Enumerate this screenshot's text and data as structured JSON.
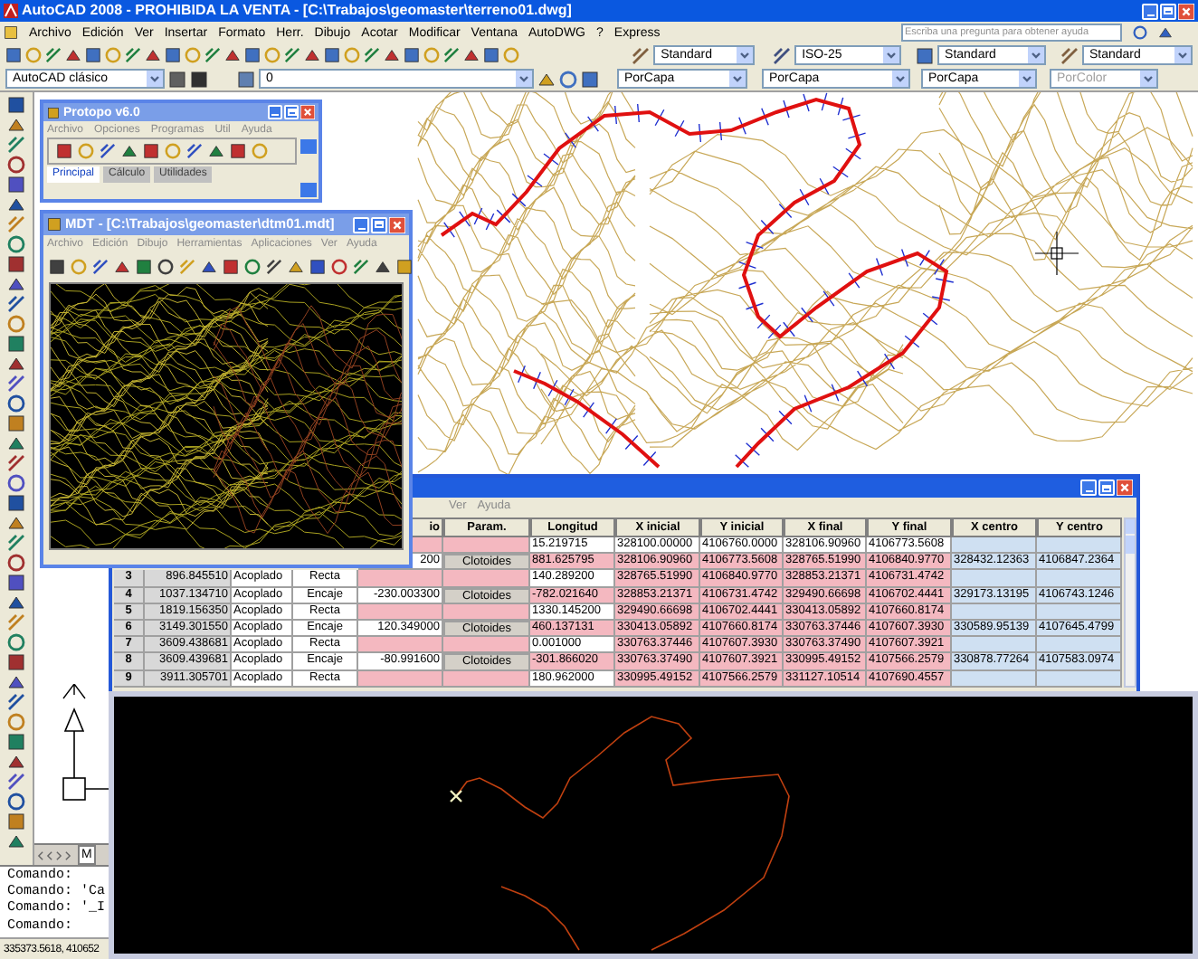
{
  "window": {
    "title": "AutoCAD 2008 - PROHIBIDA LA VENTA - [C:\\Trabajos\\geomaster\\terreno01.dwg]"
  },
  "menu": [
    "Archivo",
    "Edición",
    "Ver",
    "Insertar",
    "Formato",
    "Herr.",
    "Dibujo",
    "Acotar",
    "Modificar",
    "Ventana",
    "AutoDWG",
    "?",
    "Express"
  ],
  "help_search": {
    "placeholder": "Escriba una pregunta para obtener ayuda"
  },
  "toolbar_1": {
    "text_style": "Standard",
    "dim_style": "ISO-25",
    "table_style": "Standard",
    "multileader_style": "Standard"
  },
  "toolbar_2": {
    "workspace": "AutoCAD clásico",
    "layer": "0",
    "color_setting": "PorCapa",
    "linetype": "PorCapa",
    "lineweight": "PorCapa",
    "plot_style": {
      "value": "PorColor",
      "disabled": true
    }
  },
  "layout_tabs": [
    "M"
  ],
  "protopo": {
    "title": "Protopo v6.0",
    "menu": [
      "Archivo",
      "Opciones",
      "Programas",
      "Util",
      "Ayuda"
    ],
    "tabs": [
      {
        "label": "Principal",
        "selected": true
      },
      {
        "label": "Cálculo",
        "selected": false
      },
      {
        "label": "Utilidades",
        "selected": false
      }
    ]
  },
  "mdt": {
    "title": "MDT - [C:\\Trabajos\\geomaster\\dtm01.mdt]",
    "menu": [
      "Archivo",
      "Edición",
      "Dibujo",
      "Herramientas",
      "Aplicaciones",
      "Ver",
      "Ayuda"
    ]
  },
  "alignment_table": {
    "menu": [
      "Ver",
      "Ayuda"
    ],
    "columns": [
      "io",
      "Param.",
      "Longitud",
      "X inicial",
      "Y inicial",
      "X final",
      "Y final",
      "X centro",
      "Y centro"
    ],
    "rows": [
      {
        "kind": "start",
        "longitud": "15.219715",
        "x_inicial": "328100.00000",
        "y_inicial": "4106760.0000",
        "x_final": "328106.90960",
        "y_final": "4106773.5608"
      },
      {
        "kind": "encaje",
        "io": "200",
        "param": "Clotoides",
        "longitud": "881.625795",
        "x_inicial": "328106.90960",
        "y_inicial": "4106773.5608",
        "x_final": "328765.51990",
        "y_final": "4106840.9770",
        "x_centro": "328432.12363",
        "y_centro": "4106847.2364"
      },
      {
        "kind": "recta",
        "number": "3",
        "station": "896.845510",
        "link": "Acoplado",
        "type": "Recta",
        "longitud": "140.289200",
        "x_inicial": "328765.51990",
        "y_inicial": "4106840.9770",
        "x_final": "328853.21371",
        "y_final": "4106731.4742"
      },
      {
        "kind": "encaje",
        "number": "4",
        "station": "1037.134710",
        "link": "Acoplado",
        "type": "Encaje",
        "io": "-230.003300",
        "param": "Clotoides",
        "longitud": "-782.021640",
        "x_inicial": "328853.21371",
        "y_inicial": "4106731.4742",
        "x_final": "329490.66698",
        "y_final": "4106702.4441",
        "x_centro": "329173.13195",
        "y_centro": "4106743.1246"
      },
      {
        "kind": "recta",
        "number": "5",
        "station": "1819.156350",
        "link": "Acoplado",
        "type": "Recta",
        "longitud": "1330.145200",
        "x_inicial": "329490.66698",
        "y_inicial": "4106702.4441",
        "x_final": "330413.05892",
        "y_final": "4107660.8174"
      },
      {
        "kind": "encaje",
        "number": "6",
        "station": "3149.301550",
        "link": "Acoplado",
        "type": "Encaje",
        "io": "120.349000",
        "param": "Clotoides",
        "longitud": "460.137131",
        "x_inicial": "330413.05892",
        "y_inicial": "4107660.8174",
        "x_final": "330763.37446",
        "y_final": "4107607.3930",
        "x_centro": "330589.95139",
        "y_centro": "4107645.4799"
      },
      {
        "kind": "recta",
        "number": "7",
        "station": "3609.438681",
        "link": "Acoplado",
        "type": "Recta",
        "longitud": "0.001000",
        "x_inicial": "330763.37446",
        "y_inicial": "4107607.3930",
        "x_final": "330763.37490",
        "y_final": "4107607.3921"
      },
      {
        "kind": "encaje",
        "number": "8",
        "station": "3609.439681",
        "link": "Acoplado",
        "type": "Encaje",
        "io": "-80.991600",
        "param": "Clotoides",
        "longitud": "-301.866020",
        "x_inicial": "330763.37490",
        "y_inicial": "4107607.3921",
        "x_final": "330995.49152",
        "y_final": "4107566.2579",
        "x_centro": "330878.77264",
        "y_centro": "4107583.0974"
      },
      {
        "kind": "recta",
        "number": "9",
        "station": "3911.305701",
        "link": "Acoplado",
        "type": "Recta",
        "longitud": "180.962000",
        "x_inicial": "330995.49152",
        "y_inicial": "4107566.2579",
        "x_final": "331127.10514",
        "y_final": "4107690.4557"
      }
    ]
  },
  "command_line": {
    "lines": [
      "Comando:",
      "Comando: 'Ca",
      "Comando: '_I",
      "Comando:"
    ]
  },
  "status_bar": {
    "coordinates": "335373.5618, 410652"
  }
}
